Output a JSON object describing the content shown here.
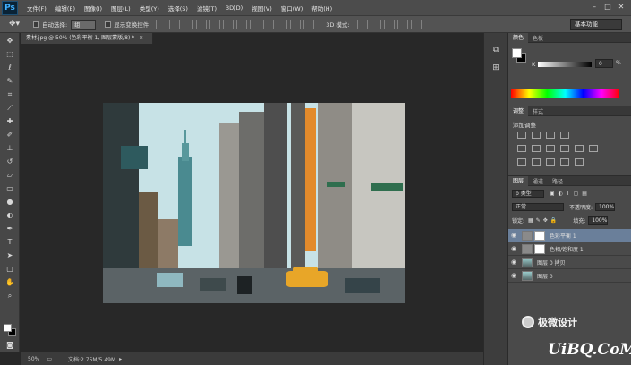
{
  "app": {
    "logo": "Ps"
  },
  "menu": [
    "文件(F)",
    "编辑(E)",
    "图像(I)",
    "图层(L)",
    "类型(Y)",
    "选择(S)",
    "滤镜(T)",
    "3D(D)",
    "视图(V)",
    "窗口(W)",
    "帮助(H)"
  ],
  "options": {
    "auto_select_label": "自动选择:",
    "auto_select_value": "组",
    "show_transform_label": "显示变换控件",
    "mode_label": "3D 模式:",
    "workspace": "基本功能"
  },
  "document": {
    "tab_title": "素材.jpg @ 50% (色彩平衡 1, 图层蒙版/8) *",
    "zoom": "50%",
    "doc_info": "文档:2.75M/5.49M"
  },
  "panels": {
    "color_tabs": [
      "颜色",
      "色板"
    ],
    "color_k_label": "K",
    "color_k_value": "0",
    "color_pct": "%",
    "adjust_tabs": [
      "调整",
      "样式"
    ],
    "adjust_title": "添加调整",
    "layers_tabs": [
      "图层",
      "通道",
      "路径"
    ],
    "filter_kind": "ρ 类型",
    "blend_mode": "正常",
    "opacity_label": "不透明度:",
    "opacity_value": "100%",
    "lock_label": "锁定:",
    "fill_label": "填充:",
    "fill_value": "100%",
    "layers": [
      {
        "name": "色彩平衡 1",
        "type": "adjustment"
      },
      {
        "name": "色相/饱和度 1",
        "type": "adjustment"
      },
      {
        "name": "图层 0 拷贝",
        "type": "image"
      },
      {
        "name": "图层 0",
        "type": "image"
      }
    ]
  },
  "watermark": {
    "line1": "极微设计",
    "line2": "UiBQ.CoM"
  },
  "colors": {
    "accent_blue": "#3fb0ff",
    "selected_layer": "#6a7f9a",
    "taxi": "#e8a628"
  }
}
